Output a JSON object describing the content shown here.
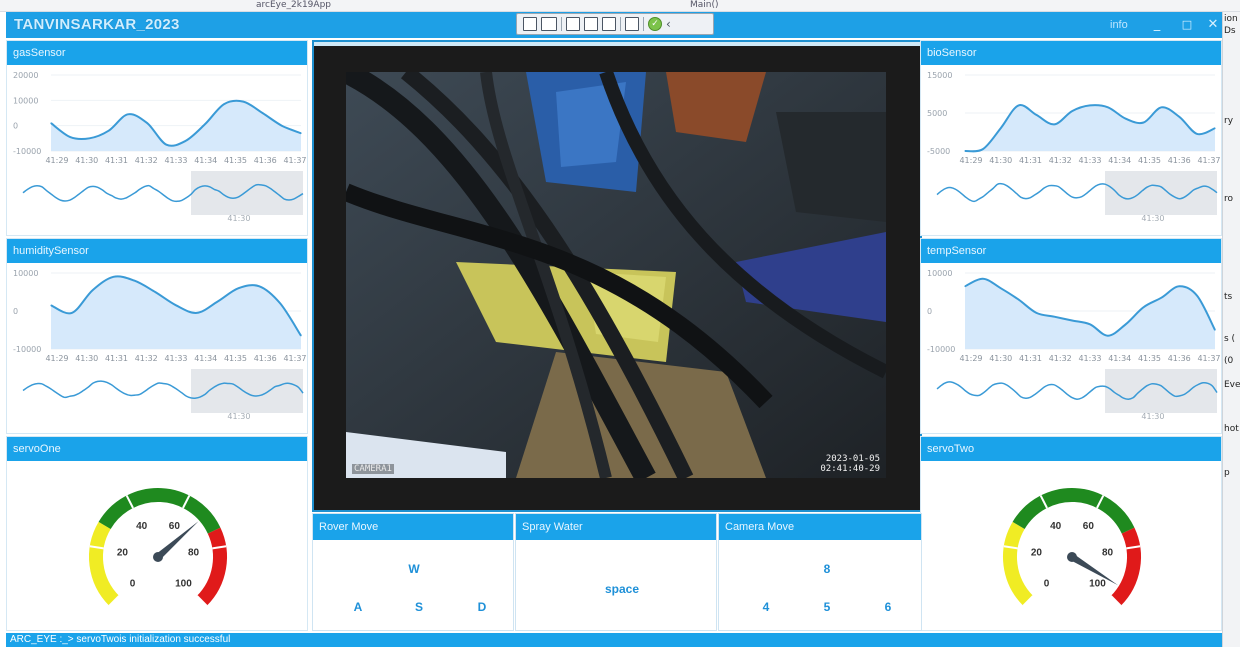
{
  "host": {
    "tab_left": "arcEye_2k19App",
    "tab_mid": "Main()",
    "snippets": [
      "ion",
      "Ds",
      "ry",
      "ro",
      "ts",
      "s (",
      "(0",
      "Eve",
      "hot",
      "p"
    ]
  },
  "app": {
    "title": "TANVINSARKAR_2023",
    "info_label": "info",
    "minimize": "_",
    "maximize": "□",
    "close": "✕"
  },
  "colors": {
    "accent": "#1aa3ea",
    "line": "#3a9ad6",
    "fill": "#d6e9fb",
    "gauge_green": "#1f8a1f",
    "gauge_yellow": "#f0ec24",
    "gauge_red": "#e01a1a",
    "key": "#1e90d8"
  },
  "charts": {
    "time_ticks": [
      "41:29",
      "41:30",
      "41:31",
      "41:32",
      "41:33",
      "41:34",
      "41:35",
      "41:36",
      "41:37"
    ],
    "navigator_label": "41:30",
    "gas": {
      "title": "gasSensor",
      "yticks": [
        "20000",
        "10000",
        "0",
        "-10000"
      ],
      "ymax": 20000,
      "ymin": -10000,
      "values": [
        1000,
        -4500,
        -5000,
        -2000,
        4500,
        1000,
        -7500,
        -6000,
        500,
        8500,
        9500,
        5000,
        0,
        -3000
      ]
    },
    "bio": {
      "title": "bioSensor",
      "yticks": [
        "15000",
        "5000",
        "-5000"
      ],
      "ymax": 15000,
      "ymin": -5000,
      "values": [
        -5000,
        -4500,
        1000,
        7000,
        4500,
        2000,
        5500,
        7000,
        6500,
        3500,
        2500,
        6500,
        4000,
        -500,
        1000
      ]
    },
    "humidity": {
      "title": "humiditySensor",
      "yticks": [
        "10000",
        "0",
        "-10000"
      ],
      "ymax": 10000,
      "ymin": -10000,
      "values": [
        1500,
        -500,
        5500,
        9000,
        8000,
        5000,
        1500,
        -500,
        2500,
        6000,
        6500,
        2000,
        -6500
      ]
    },
    "temp": {
      "title": "tempSensor",
      "yticks": [
        "10000",
        "0",
        "-10000"
      ],
      "ymax": 10000,
      "ymin": -10000,
      "values": [
        6500,
        8500,
        6000,
        3000,
        -500,
        -1500,
        -2500,
        -3500,
        -6500,
        -3500,
        1000,
        3500,
        6500,
        4000,
        -5000
      ]
    }
  },
  "gauges": {
    "servoOne": {
      "title": "servoOne",
      "value": 68,
      "ticks": [
        "0",
        "20",
        "40",
        "60",
        "80",
        "100"
      ]
    },
    "servoTwo": {
      "title": "servoTwo",
      "value": 95,
      "ticks": [
        "0",
        "20",
        "40",
        "60",
        "80",
        "100"
      ]
    }
  },
  "camera": {
    "label": "CAMERA1",
    "date": "2023-01-05",
    "time": "02:41:40-29"
  },
  "controls": {
    "rover": {
      "title": "Rover Move",
      "up": "W",
      "left": "A",
      "down": "S",
      "right": "D"
    },
    "spray": {
      "title": "Spray Water",
      "key": "space"
    },
    "camera": {
      "title": "Camera Move",
      "up": "8",
      "left": "4",
      "down": "5",
      "right": "6"
    }
  },
  "status": {
    "text": "ARC_EYE :_> servoTwois initialization successful"
  }
}
